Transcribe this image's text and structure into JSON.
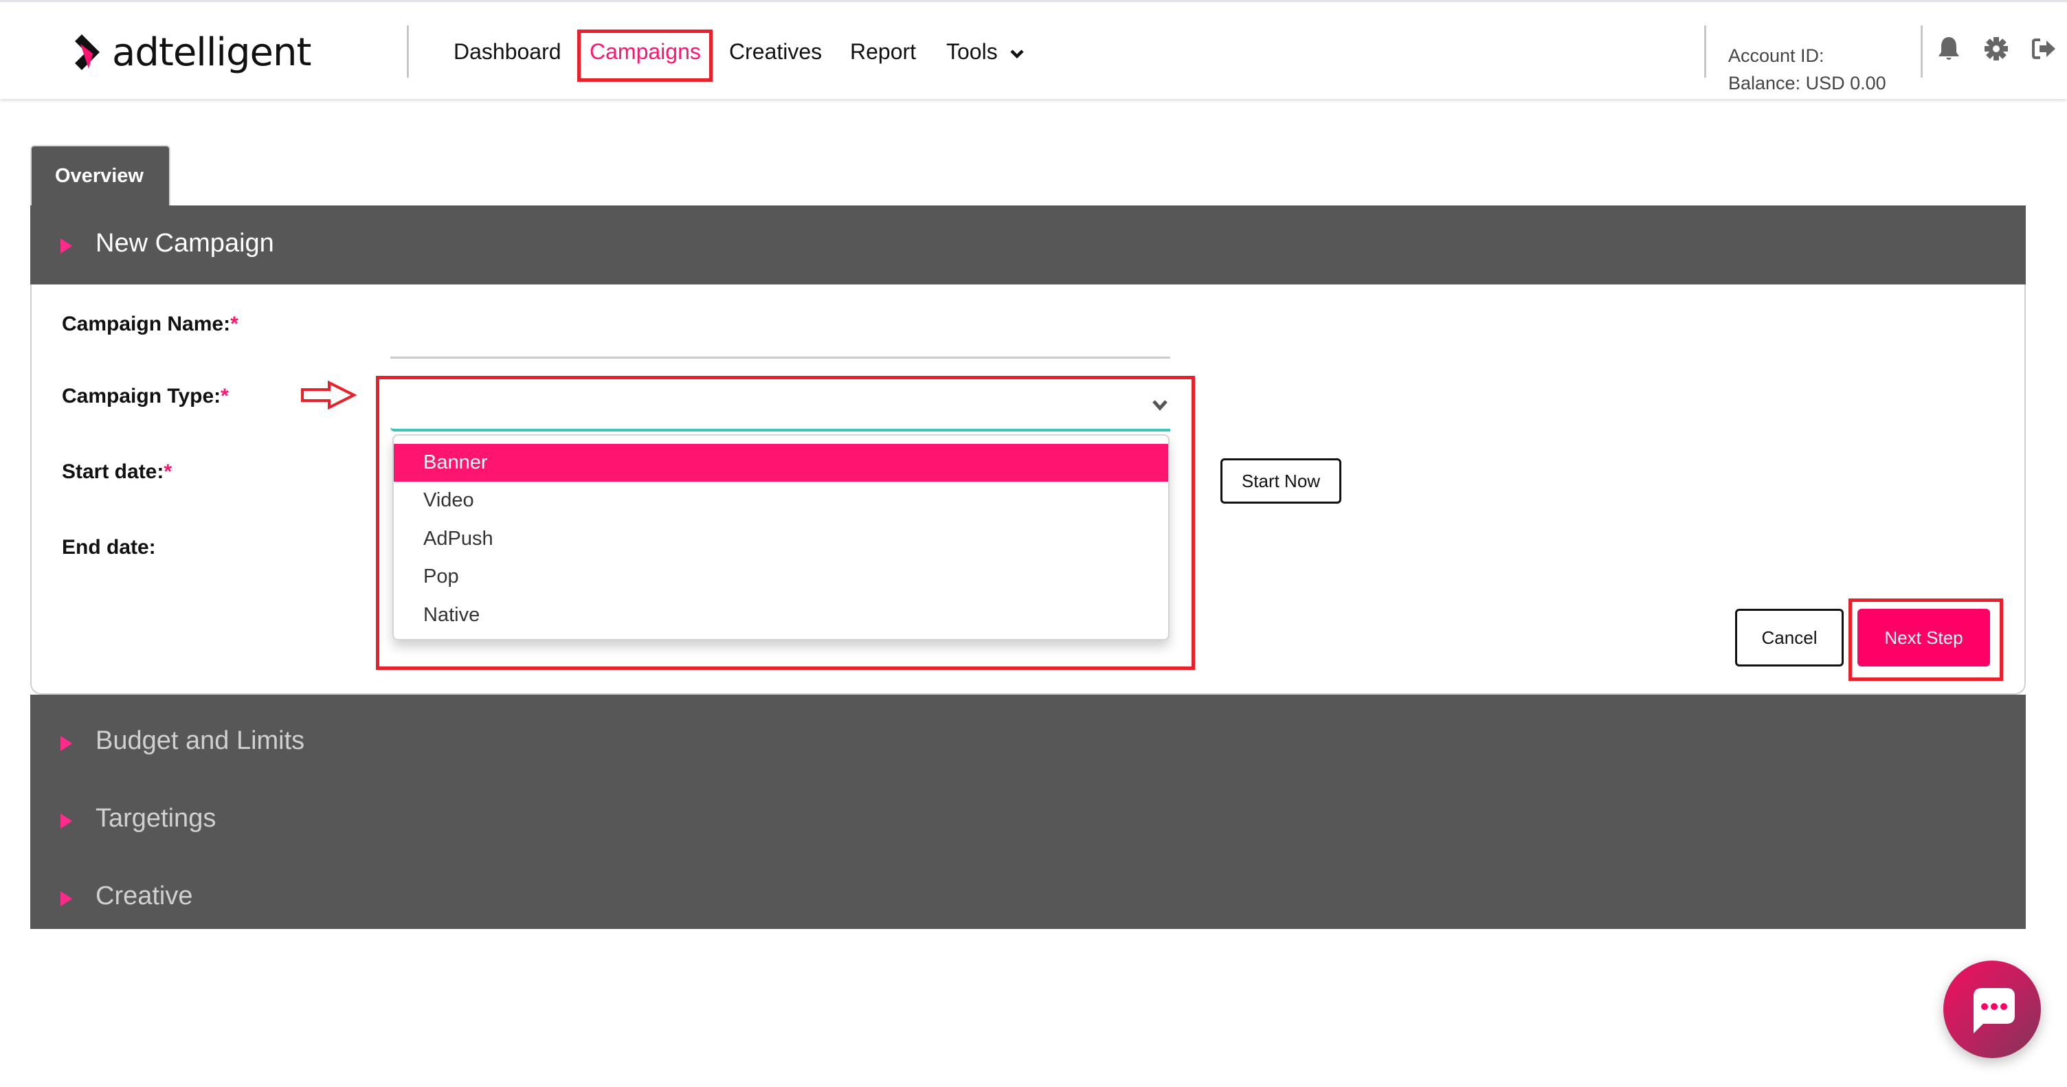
{
  "header": {
    "logo_text": "adtelligent",
    "nav": [
      {
        "label": "Dashboard",
        "active": false
      },
      {
        "label": "Campaigns",
        "active": true
      },
      {
        "label": "Creatives",
        "active": false
      },
      {
        "label": "Report",
        "active": false
      },
      {
        "label": "Tools",
        "active": false,
        "has_dropdown": true
      }
    ],
    "account_id_label": "Account ID:",
    "balance_label": "Balance: USD 0.00",
    "icons": [
      "bell-icon",
      "gear-icon",
      "logout-icon"
    ]
  },
  "tabs": [
    {
      "label": "Overview",
      "active": true
    }
  ],
  "sections": {
    "new_campaign": "New Campaign",
    "budget": "Budget and Limits",
    "targetings": "Targetings",
    "creative": "Creative"
  },
  "form": {
    "campaign_name_label": "Campaign Name:",
    "campaign_name_value": "",
    "campaign_type_label": "Campaign Type:",
    "campaign_type_value": "",
    "start_date_label": "Start date:",
    "end_date_label": "End date:",
    "required_mark": "*",
    "campaign_type_options": [
      {
        "label": "Banner",
        "highlighted": true
      },
      {
        "label": "Video",
        "highlighted": false
      },
      {
        "label": "AdPush",
        "highlighted": false
      },
      {
        "label": "Pop",
        "highlighted": false
      },
      {
        "label": "Native",
        "highlighted": false
      }
    ],
    "start_now_label": "Start Now",
    "cancel_label": "Cancel",
    "next_step_label": "Next Step"
  },
  "colors": {
    "brand": "#ff1470",
    "panel": "#575757",
    "focus_underline": "#3cc4bd",
    "annotation": "#e8202a"
  }
}
